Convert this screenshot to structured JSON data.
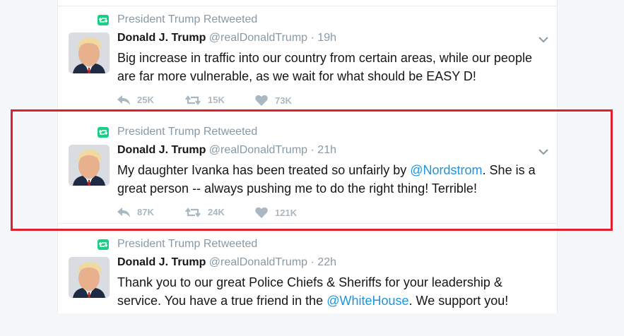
{
  "accent_colors": {
    "retweet": "#19cf86",
    "link": "#1b95e0",
    "highlight": "#e0202c"
  },
  "tweets": [
    {
      "retweet_label": "President Trump Retweeted",
      "name": "Donald J. Trump",
      "handle": "@realDonaldTrump",
      "time": "19h",
      "text_before": "Big increase in traffic into our country from certain areas, while our people are far more vulnerable, as we wait for what should be EASY D!",
      "mention": "",
      "text_after": "",
      "replies": "25K",
      "retweets": "15K",
      "likes": "73K"
    },
    {
      "retweet_label": "President Trump Retweeted",
      "name": "Donald J. Trump",
      "handle": "@realDonaldTrump",
      "time": "21h",
      "text_before": "My daughter Ivanka has been treated so unfairly by ",
      "mention": "@Nordstrom",
      "text_after": ". She is a great person -- always pushing me to do the right thing! Terrible!",
      "replies": "87K",
      "retweets": "24K",
      "likes": "121K"
    },
    {
      "retweet_label": "President Trump Retweeted",
      "name": "Donald J. Trump",
      "handle": "@realDonaldTrump",
      "time": "22h",
      "text_before": "Thank you to our great Police Chiefs & Sheriffs for your leadership & service. You have a true friend in the ",
      "mention": "@WhiteHouse",
      "text_after": ". We support you!",
      "replies": "",
      "retweets": "",
      "likes": ""
    }
  ]
}
